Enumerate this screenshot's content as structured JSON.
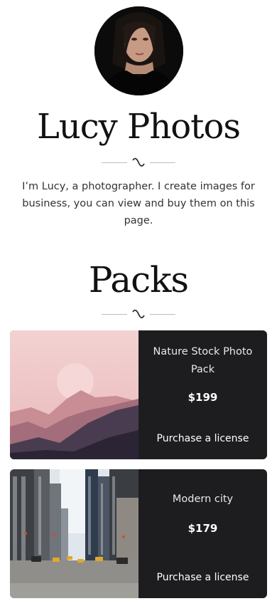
{
  "profile": {
    "name": "Lucy Photos",
    "bio": "I’m Lucy, a photographer. I create images for business, you can view and buy them on this page."
  },
  "packs_section": {
    "heading": "Packs",
    "packs": [
      {
        "name": "Nature Stock Photo Pack",
        "price": "$199",
        "button_label": "Purchase a license",
        "image": "mountains-photo"
      },
      {
        "name": "Modern city",
        "price": "$179",
        "button_label": "Purchase a license",
        "image": "city-street-photo"
      }
    ]
  }
}
